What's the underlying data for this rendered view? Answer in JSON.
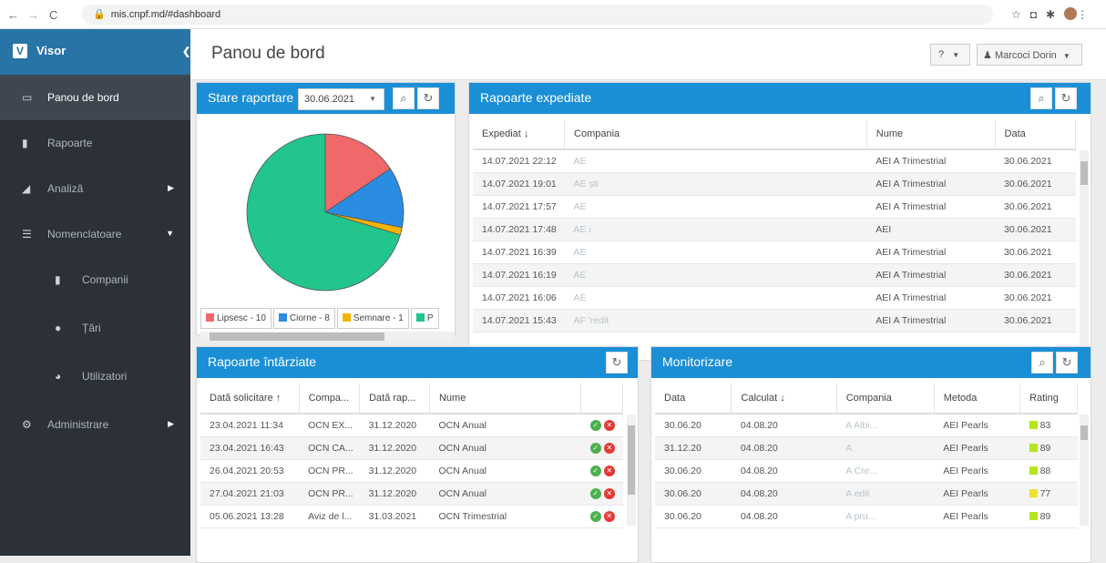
{
  "browser": {
    "url": "mis.cnpf.md/#dashboard"
  },
  "sidebar": {
    "brand": "Visor",
    "items": [
      {
        "label": "Panou de bord",
        "icon": "monitor-icon"
      },
      {
        "label": "Rapoarte",
        "icon": "file-icon"
      },
      {
        "label": "Analiză",
        "icon": "area-chart-icon"
      },
      {
        "label": "Nomenclatoare",
        "icon": "list-icon"
      },
      {
        "label": "Companii",
        "icon": "building-icon"
      },
      {
        "label": "Țări",
        "icon": "globe-icon"
      },
      {
        "label": "Utilizatori",
        "icon": "users-icon"
      },
      {
        "label": "Administrare",
        "icon": "gears-icon"
      }
    ]
  },
  "header": {
    "title": "Panou de bord",
    "help": "?",
    "user": "Marcoci Dorin"
  },
  "stare": {
    "title": "Stare raportare",
    "date": "30.06.2021",
    "legend": [
      {
        "label": "Lipsesc - 10",
        "color": "#f0686a"
      },
      {
        "label": "Ciorne - 8",
        "color": "#2b8ce3"
      },
      {
        "label": "Semnare - 1",
        "color": "#f4b400"
      },
      {
        "label": "P",
        "color": "#22c58b"
      }
    ]
  },
  "chart_data": {
    "type": "pie",
    "labels": [
      "Lipsesc",
      "Ciorne",
      "Semnare",
      "P"
    ],
    "values": [
      10,
      8,
      1,
      45
    ],
    "colors": [
      "#f0686a",
      "#2b8ce3",
      "#f4b400",
      "#22c58b"
    ]
  },
  "expediate": {
    "title": "Rapoarte expediate",
    "columns": [
      "Expediat ↓",
      "Compania",
      "Nume",
      "Data"
    ],
    "rows": [
      [
        "14.07.2021 22:12",
        "AE",
        "AEI A Trimestrial",
        "30.06.2021"
      ],
      [
        "14.07.2021 19:01",
        "AE                ști",
        "AEI A Trimestrial",
        "30.06.2021"
      ],
      [
        "14.07.2021 17:57",
        "AE",
        "AEI A Trimestrial",
        "30.06.2021"
      ],
      [
        "14.07.2021 17:48",
        "AE              i",
        "AEI",
        "30.06.2021"
      ],
      [
        "14.07.2021 16:39",
        "AE",
        "AEI A Trimestrial",
        "30.06.2021"
      ],
      [
        "14.07.2021 16:19",
        "AE",
        "AEI A Trimestrial",
        "30.06.2021"
      ],
      [
        "14.07.2021 16:06",
        "AE",
        "AEI A Trimestrial",
        "30.06.2021"
      ],
      [
        "14.07.2021 15:43",
        "AF              'redit",
        "AEI A Trimestrial",
        "30.06.2021"
      ]
    ]
  },
  "intarziate": {
    "title": "Rapoarte întârziate",
    "columns": [
      "Dată solicitare ↑",
      "Compa...",
      "Dată rap...",
      "Nume",
      ""
    ],
    "rows": [
      [
        "23.04.2021 11:34",
        "OCN EX...",
        "31.12.2020",
        "OCN Anual"
      ],
      [
        "23.04.2021 16:43",
        "OCN CA...",
        "31.12.2020",
        "OCN Anual"
      ],
      [
        "26.04.2021 20:53",
        "OCN PR...",
        "31.12.2020",
        "OCN Anual"
      ],
      [
        "27.04.2021 21:03",
        "OCN PR...",
        "31.12.2020",
        "OCN Anual"
      ],
      [
        "05.06.2021 13:28",
        "Aviz de l...",
        "31.03.2021",
        "OCN Trimestrial"
      ]
    ]
  },
  "monitorizare": {
    "title": "Monitorizare",
    "columns": [
      "Data",
      "Calculat ↓",
      "Compania",
      "Metoda",
      "Rating"
    ],
    "rows": [
      [
        "30.06.20",
        "04.08.20",
        "A              Albi...",
        "AEI Pearls",
        "83"
      ],
      [
        "31.12.20",
        "04.08.20",
        "A",
        "AEI Pearls",
        "89"
      ],
      [
        "30.06.20",
        "04.08.20",
        "A             Cre...",
        "AEI Pearls",
        "88"
      ],
      [
        "30.06.20",
        "04.08.20",
        "A             edit",
        "AEI Pearls",
        "77"
      ],
      [
        "30.06.20",
        "04.08.20",
        "A             pru...",
        "AEI Pearls",
        "89"
      ]
    ],
    "rating_colors": [
      "#b5e61d",
      "#b5e61d",
      "#b5e61d",
      "#f0e130",
      "#b5e61d"
    ]
  }
}
